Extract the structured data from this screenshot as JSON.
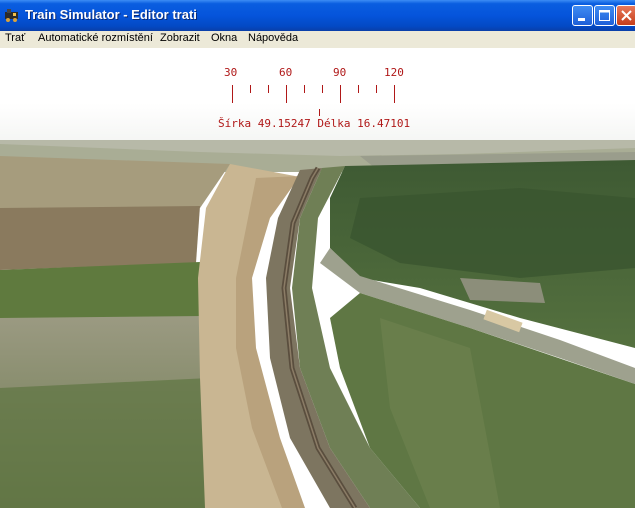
{
  "window": {
    "title": "Train Simulator - Editor trati",
    "controls": [
      "minimize-icon",
      "maximize-icon",
      "close-icon"
    ]
  },
  "menu": {
    "items": [
      {
        "label": "Trať"
      },
      {
        "label": "Automatické rozmístění"
      },
      {
        "label": "Zobrazit"
      },
      {
        "label": "Okna"
      },
      {
        "label": "Nápověda"
      }
    ]
  },
  "hud": {
    "scale_labels": [
      "30",
      "60",
      "90",
      "120"
    ],
    "latitude_label": "Šírka",
    "latitude_value": "49.15247",
    "longitude_label": "Délka",
    "longitude_value": "16.47101",
    "color": "#b01818"
  },
  "colors": {
    "titlebar": "#0554db",
    "menubar": "#ece9d8",
    "hud": "#b01818"
  }
}
